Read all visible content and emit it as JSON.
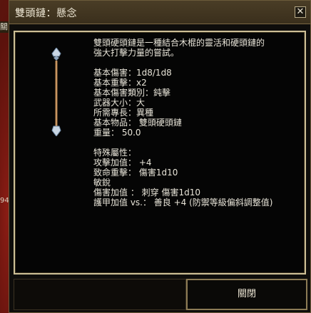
{
  "background": {
    "side_label": "關",
    "side_number": "94"
  },
  "window": {
    "title": "雙頭鏈：懸念",
    "close_glyph": "✕"
  },
  "item": {
    "icon": "double-headed-flail-icon",
    "description": [
      "雙頭硬頭鏈是一種結合木棍的靈活和硬頭鏈的",
      "強大打擊力量的嘗試。"
    ],
    "stats": [
      "基本傷害：1d8/1d8",
      "基本重擊：x2",
      "基本傷害類別：鈍擊",
      "武器大小：大",
      "所需專長：異種",
      "基本物品： 雙頭硬頭鏈",
      "重量： 50.0"
    ],
    "properties": [
      "特殊屬性：",
      "攻擊加值： +4",
      "致命重擊： 傷害1d10",
      "敏銳",
      "傷害加值 ： 刺穿 傷害1d10",
      "護甲加值 vs.： 善良 +4 (防禦等級偏斜調整值)"
    ]
  },
  "footer": {
    "close_label": "關閉"
  }
}
